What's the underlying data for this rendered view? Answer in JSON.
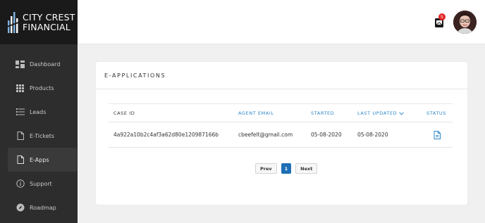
{
  "brand": {
    "line1": "CITY CREST",
    "line2": "FINANCIAL"
  },
  "sidebar": {
    "items": [
      {
        "label": "Dashboard",
        "icon": "dashboard-icon"
      },
      {
        "label": "Products",
        "icon": "grid-icon"
      },
      {
        "label": "Leads",
        "icon": "list-icon"
      },
      {
        "label": "E-Tickets",
        "icon": "document-icon"
      },
      {
        "label": "E-Apps",
        "icon": "document-icon",
        "active": true
      },
      {
        "label": "Support",
        "icon": "info-icon"
      },
      {
        "label": "Roadmap",
        "icon": "compass-icon"
      }
    ]
  },
  "header": {
    "notification_count": "5"
  },
  "card": {
    "title": "E-APPLICATIONS",
    "columns": [
      "CASE ID",
      "AGENT EMAIL",
      "STARTED",
      "LAST UPDATED",
      "STATUS"
    ],
    "rows": [
      {
        "case_id": "4a922a10b2c4af3a62d80e120987166b",
        "agent_email": "cbeefelt@gmail.com",
        "started": "05-08-2020",
        "last_updated": "05-08-2020",
        "status_icon": "document-icon"
      }
    ]
  },
  "pagination": {
    "prev": "Prev",
    "current": "1",
    "next": "Next"
  },
  "colors": {
    "accent": "#2a86c9",
    "sidebar": "#2d2d2d",
    "badge": "#e02424",
    "active_page": "#1e6fb5"
  }
}
